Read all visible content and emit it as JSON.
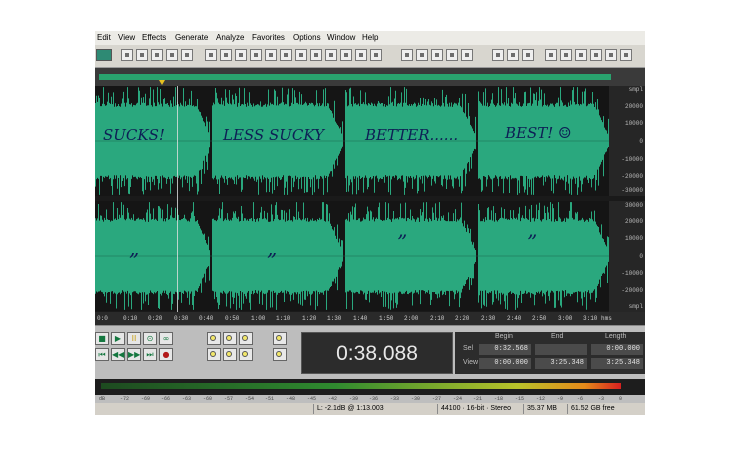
{
  "menu": [
    "Edit",
    "View",
    "Effects",
    "Generate",
    "Analyze",
    "Favorites",
    "Options",
    "Window",
    "Help"
  ],
  "annotations": {
    "top": [
      "SUCKS!",
      "LESS SUCKY",
      "BETTER......",
      "BEST! ☺"
    ],
    "bottom": [
      "„",
      "„",
      "”",
      "”"
    ]
  },
  "db_scale": {
    "top": [
      "smpl",
      "20000",
      "10000",
      "0",
      "-10000",
      "-20000",
      "-30000"
    ],
    "bottom": [
      "30000",
      "20000",
      "10000",
      "0",
      "-10000",
      "-20000",
      "smpl"
    ]
  },
  "timeline": [
    "0:0",
    "0:10",
    "0:20",
    "0:30",
    "0:40",
    "0:50",
    "1:00",
    "1:10",
    "1:20",
    "1:30",
    "1:40",
    "1:50",
    "2:00",
    "2:10",
    "2:20",
    "2:30",
    "2:40",
    "2:50",
    "3:00",
    "3:10",
    "hms"
  ],
  "time_display": "0:38.088",
  "selection": {
    "headers": {
      "begin": "Begin",
      "end": "End",
      "length": "Length"
    },
    "sel": {
      "label": "Sel",
      "begin": "0:32.568",
      "end": "",
      "length": "0:00.000"
    },
    "view": {
      "label": "View",
      "begin": "0:00.000",
      "end": "3:25.348",
      "length": "3:25.348"
    }
  },
  "meter_scale": [
    "dB",
    "-72",
    "-69",
    "-66",
    "-63",
    "-60",
    "-57",
    "-54",
    "-51",
    "-48",
    "-45",
    "-42",
    "-39",
    "-36",
    "-33",
    "-30",
    "-27",
    "-24",
    "-21",
    "-18",
    "-15",
    "-12",
    "-9",
    "-6",
    "-3",
    "0"
  ],
  "status": {
    "left": "L: -2.1dB @ 1:13.003",
    "format": "44100 · 16-bit · Stereo",
    "size": "35.37 MB",
    "free": "61.52 GB free"
  },
  "colors": {
    "waveform": "#2aa87e",
    "wave_bg": "#1a1a1a",
    "accent": "#29a36e"
  },
  "icons": [
    "new-icon",
    "open-icon",
    "save-icon",
    "undo-icon",
    "redo-icon",
    "cut-icon",
    "copy-icon",
    "paste-icon",
    "mix-paste-icon",
    "trim-icon",
    "zoom-icon",
    "play-icon",
    "pause-icon",
    "stop-icon",
    "record-icon",
    "loop-icon"
  ]
}
